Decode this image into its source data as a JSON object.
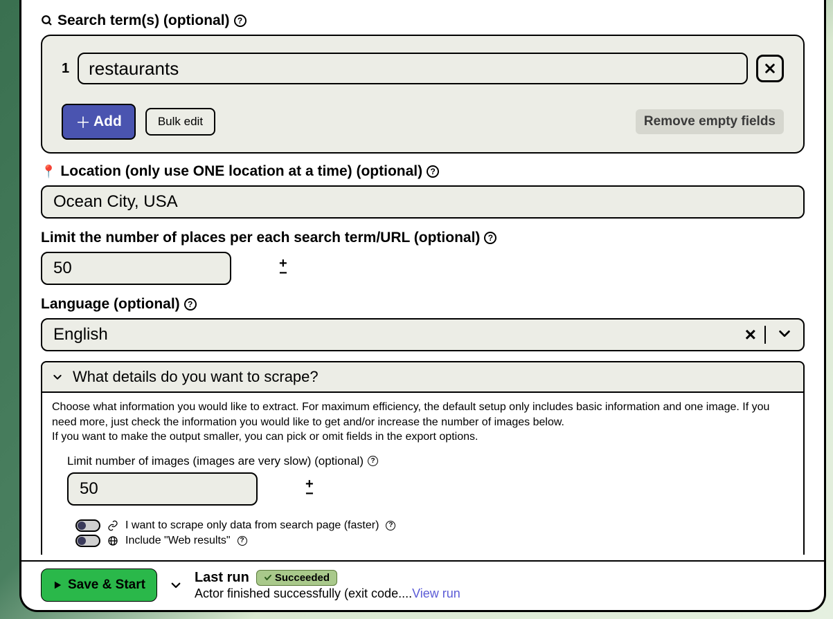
{
  "searchTerms": {
    "label": "Search term(s) (optional)",
    "items": [
      {
        "index": "1",
        "value": "restaurants"
      }
    ],
    "addLabel": "Add",
    "bulkEditLabel": "Bulk edit",
    "removeEmptyLabel": "Remove empty fields"
  },
  "location": {
    "label": "Location (only use ONE location at a time) (optional)",
    "value": "Ocean City, USA"
  },
  "limit": {
    "label": "Limit the number of places per each search term/URL (optional)",
    "value": "50"
  },
  "language": {
    "label": "Language (optional)",
    "value": "English"
  },
  "details": {
    "header": "What details do you want to scrape?",
    "desc1": "Choose what information you would like to extract. For maximum efficiency, the default setup only includes basic information and one image. If you need more, just check the information you would like to get and/or increase the number of images below.",
    "desc2": "If you want to make the output smaller, you can pick or omit fields in the export options.",
    "imagesLabel": "Limit number of images (images are very slow) (optional)",
    "imagesValue": "50",
    "toggle1": "I want to scrape only data from search page (faster)",
    "toggle2": "Include \"Web results\""
  },
  "footer": {
    "saveLabel": "Save & Start",
    "lastRun": "Last run",
    "status": "Succeeded",
    "message": "Actor finished successfully (exit code....",
    "viewRun": "View run"
  }
}
